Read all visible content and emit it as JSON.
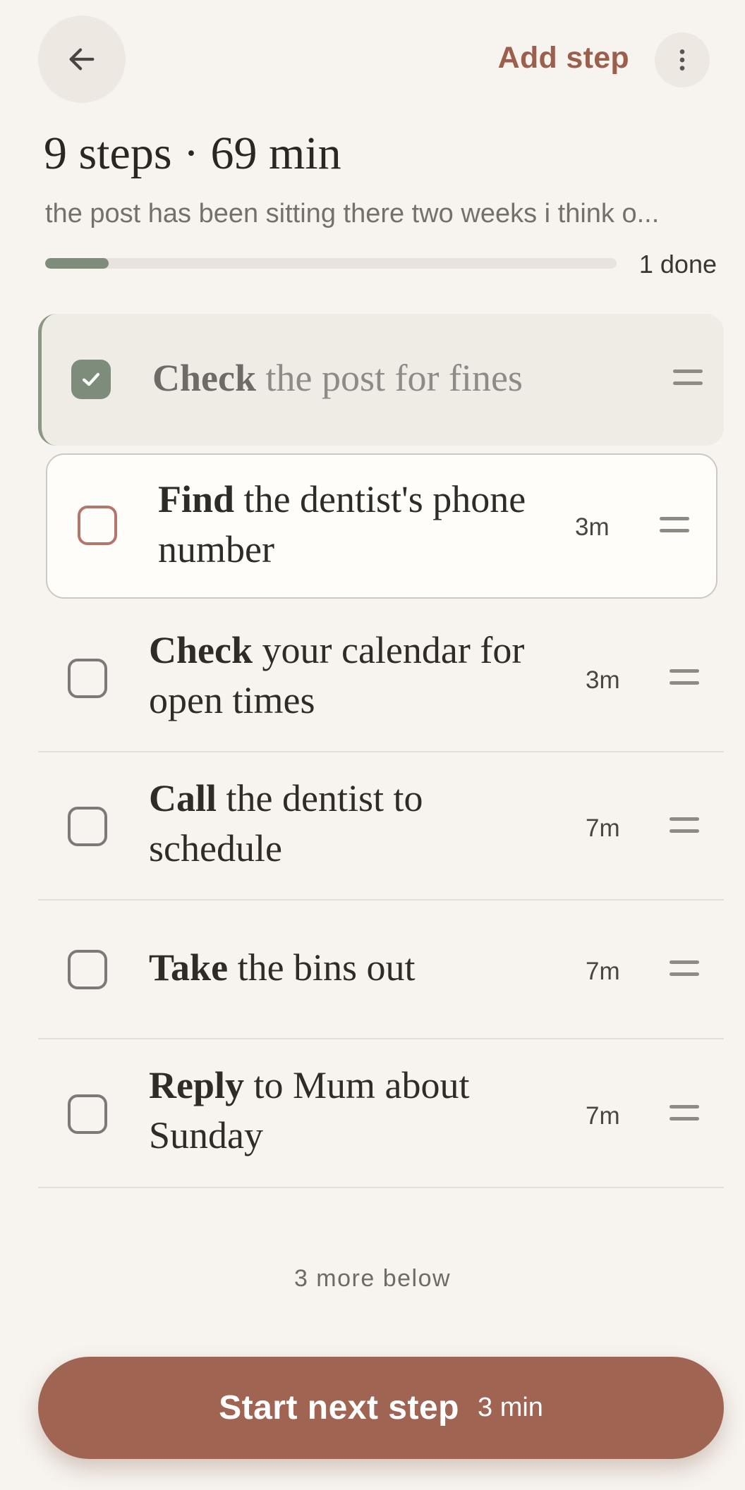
{
  "header": {
    "add_step_label": "Add step",
    "back_icon": "arrow-left-icon",
    "more_icon": "more-vertical-icon"
  },
  "summary": {
    "title": "9 steps · 69 min",
    "subtitle": "the post has been sitting there two weeks i think o...",
    "progress": {
      "done_fraction": 0.111,
      "label": "1 done"
    }
  },
  "steps": [
    {
      "verb": "Check",
      "rest": " the post for fines",
      "time": "",
      "state": "done"
    },
    {
      "verb": "Find",
      "rest": " the dentist's phone number",
      "time": "3m",
      "state": "current"
    },
    {
      "verb": "Check",
      "rest": " your calendar for open times",
      "time": "3m",
      "state": "todo"
    },
    {
      "verb": "Call",
      "rest": " the dentist to schedule",
      "time": "7m",
      "state": "todo"
    },
    {
      "verb": "Take",
      "rest": " the bins out",
      "time": "7m",
      "state": "todo"
    },
    {
      "verb": "Reply",
      "rest": " to Mum about Sunday",
      "time": "7m",
      "state": "todo"
    }
  ],
  "more_below_label": "3 more below",
  "start_button": {
    "label": "Start next step",
    "duration": "3 min"
  },
  "colors": {
    "accent": "#a06453",
    "done_green": "#7e8c7c",
    "background": "#f7f3ef"
  }
}
